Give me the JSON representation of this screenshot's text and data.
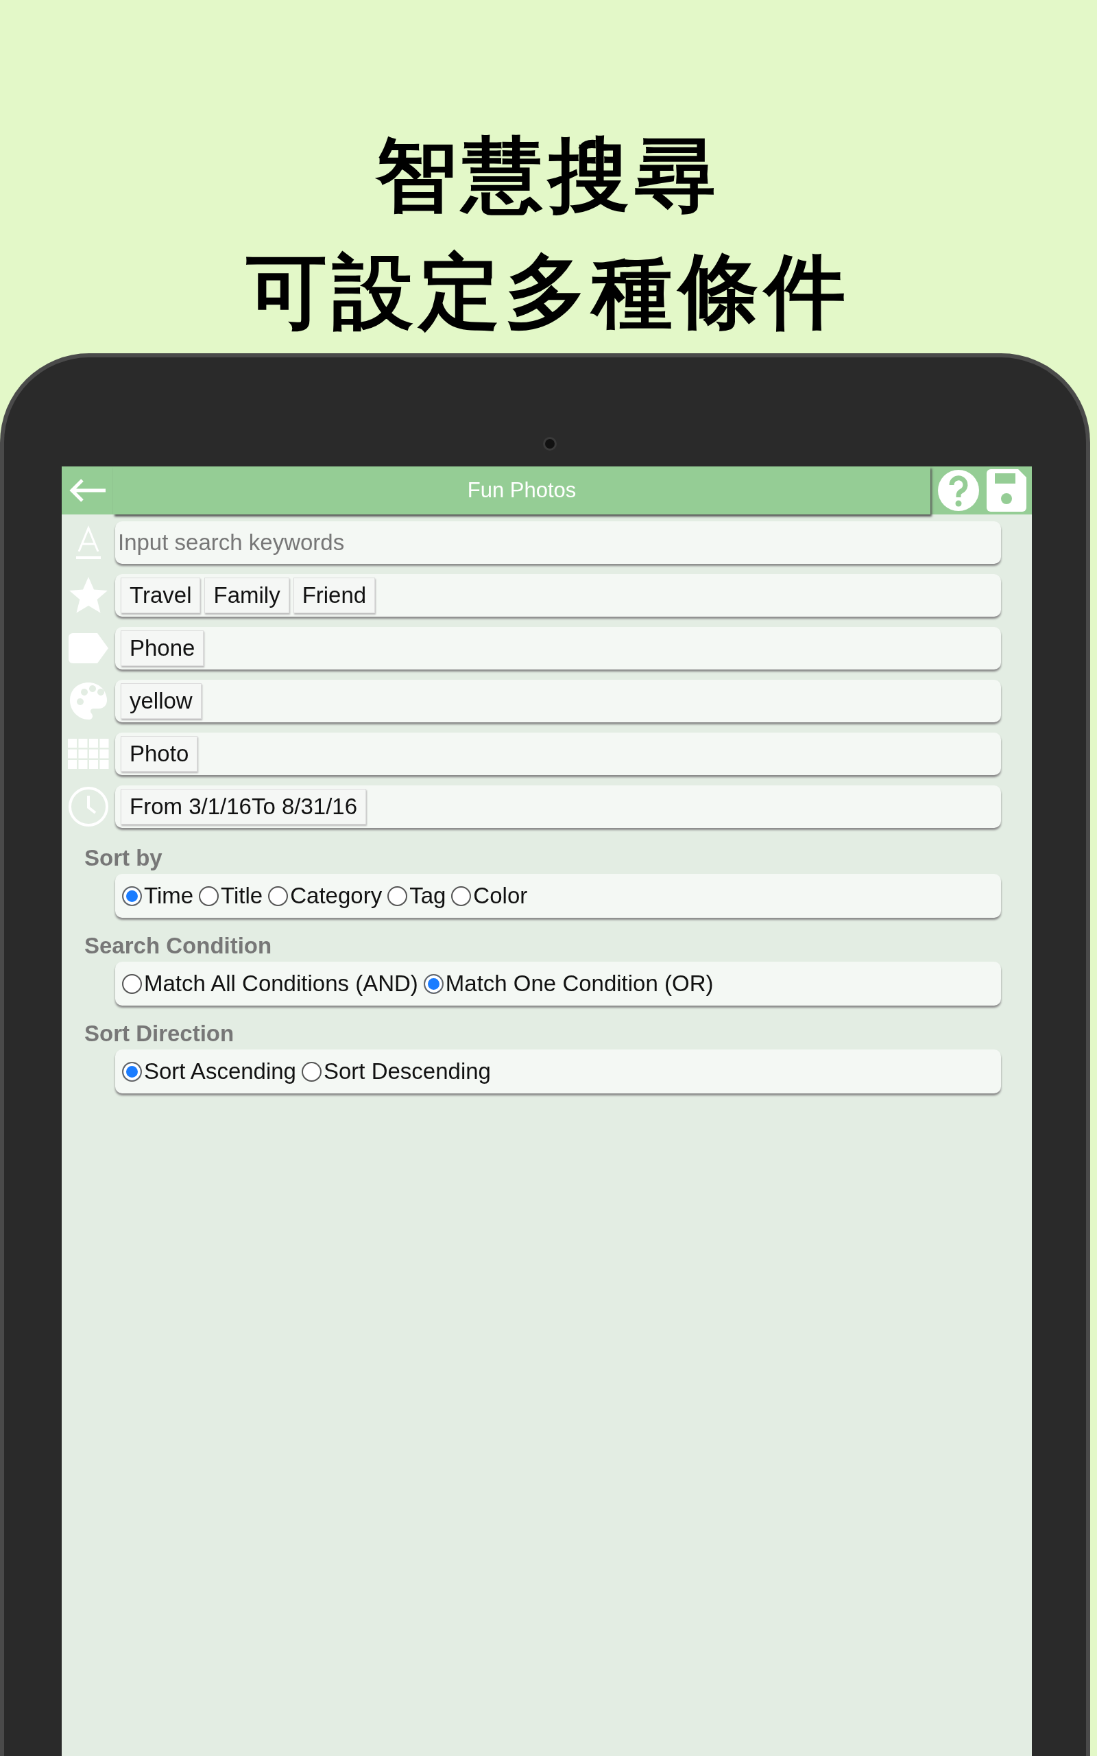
{
  "headline": [
    "智慧搜尋",
    "可設定多種條件"
  ],
  "header": {
    "title": "Fun Photos"
  },
  "search": {
    "placeholder": "Input search keywords"
  },
  "filters": [
    {
      "kind": "star",
      "chips": [
        "Travel",
        "Family",
        "Friend"
      ]
    },
    {
      "kind": "tag",
      "chips": [
        "Phone"
      ]
    },
    {
      "kind": "palette",
      "chips": [
        "yellow"
      ]
    },
    {
      "kind": "grid",
      "chips": [
        "Photo"
      ]
    },
    {
      "kind": "clock",
      "chips": [
        "From 3/1/16To 8/31/16"
      ]
    }
  ],
  "groups": [
    {
      "label": "Sort by",
      "options": [
        {
          "label": "Time",
          "selected": true
        },
        {
          "label": "Title",
          "selected": false
        },
        {
          "label": "Category",
          "selected": false
        },
        {
          "label": "Tag",
          "selected": false
        },
        {
          "label": "Color",
          "selected": false
        }
      ]
    },
    {
      "label": "Search Condition",
      "options": [
        {
          "label": "Match All Conditions (AND)",
          "selected": false
        },
        {
          "label": "Match One Condition (OR)",
          "selected": true
        }
      ]
    },
    {
      "label": "Sort Direction",
      "options": [
        {
          "label": "Sort Ascending",
          "selected": true
        },
        {
          "label": "Sort Descending",
          "selected": false
        }
      ]
    }
  ]
}
